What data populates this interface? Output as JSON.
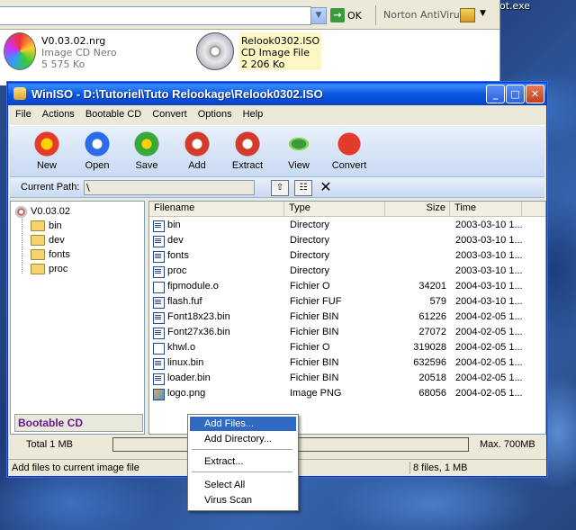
{
  "desktop": {
    "label": "ot.exe"
  },
  "explorer": {
    "go_label": "OK",
    "norton_label": "Norton AntiVirus",
    "files": [
      {
        "name": "V0.03.02.nrg",
        "type": "Image CD Nero",
        "size": "5 575 Ko"
      },
      {
        "name": "Relook0302.ISO",
        "type": "CD Image File",
        "size": "2 206 Ko"
      }
    ]
  },
  "window": {
    "title": "WinISO - D:\\Tutoriel\\Tuto Relookage\\Relook0302.ISO",
    "menu": [
      "File",
      "Actions",
      "Bootable CD",
      "Convert",
      "Options",
      "Help"
    ],
    "toolbar": [
      "New",
      "Open",
      "Save",
      "Add",
      "Extract",
      "View",
      "Convert"
    ],
    "path_label": "Current Path:",
    "path_value": "\\",
    "tree": {
      "root": "V0.03.02",
      "folders": [
        "bin",
        "dev",
        "fonts",
        "proc"
      ]
    },
    "bootable_label": "Bootable CD",
    "columns": [
      "Filename",
      "Type",
      "Size",
      "Time"
    ],
    "files": [
      {
        "name": "bin",
        "type": "Directory",
        "size": "",
        "time": "2003-03-10 1...",
        "icon": "dir"
      },
      {
        "name": "dev",
        "type": "Directory",
        "size": "",
        "time": "2003-03-10 1...",
        "icon": "dir"
      },
      {
        "name": "fonts",
        "type": "Directory",
        "size": "",
        "time": "2003-03-10 1...",
        "icon": "dir"
      },
      {
        "name": "proc",
        "type": "Directory",
        "size": "",
        "time": "2003-03-10 1...",
        "icon": "dir"
      },
      {
        "name": "fipmodule.o",
        "type": "Fichier O",
        "size": "34201",
        "time": "2004-03-10 1...",
        "icon": "file"
      },
      {
        "name": "flash.fuf",
        "type": "Fichier FUF",
        "size": "579",
        "time": "2004-03-10 1...",
        "icon": "dir"
      },
      {
        "name": "Font18x23.bin",
        "type": "Fichier BIN",
        "size": "61226",
        "time": "2004-02-05 1...",
        "icon": "dir"
      },
      {
        "name": "Font27x36.bin",
        "type": "Fichier BIN",
        "size": "27072",
        "time": "2004-02-05 1...",
        "icon": "dir"
      },
      {
        "name": "khwl.o",
        "type": "Fichier O",
        "size": "319028",
        "time": "2004-02-05 1...",
        "icon": "file"
      },
      {
        "name": "linux.bin",
        "type": "Fichier BIN",
        "size": "632596",
        "time": "2004-02-05 1...",
        "icon": "dir"
      },
      {
        "name": "loader.bin",
        "type": "Fichier BIN",
        "size": "20518",
        "time": "2004-02-05 1...",
        "icon": "dir"
      },
      {
        "name": "logo.png",
        "type": "Image PNG",
        "size": "68056",
        "time": "2004-02-05 1...",
        "icon": "png"
      }
    ],
    "total_label": "Total 1 MB",
    "max_label": "Max. 700MB",
    "status_left": "Add files to current image file",
    "status_right": "8 files, 1 MB"
  },
  "context_menu": {
    "items": [
      "Add Files...",
      "Add Directory...",
      "Extract...",
      "Select All",
      "Virus Scan"
    ]
  }
}
